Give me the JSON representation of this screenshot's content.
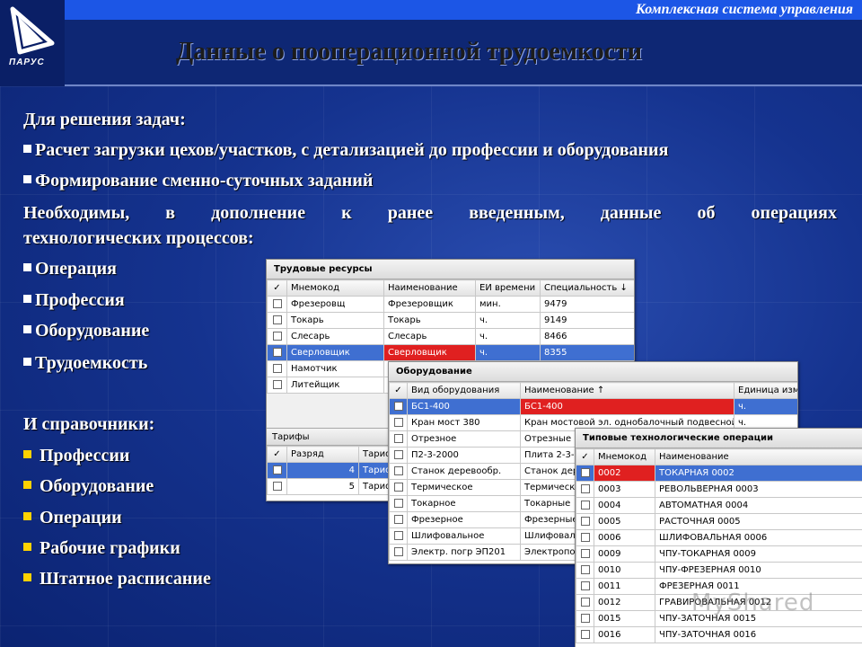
{
  "header": {
    "subtitle": "Комплексная система управления",
    "title": "Данные о пооперационной трудоемкости",
    "logo_text": "ПАРУС"
  },
  "left": {
    "heading1": "Для решения задач:",
    "tasks": [
      "Расчет загрузки цехов/участков, с детализацией до профессии и оборудования",
      "Формирование сменно-суточных заданий"
    ],
    "para_line1_words": [
      "Необходимы,",
      "в",
      "дополнение",
      "к",
      "ранее",
      "введенным,",
      "данные",
      "об",
      "операциях"
    ],
    "para_line2": "технологических процессов:",
    "data_items": [
      "Операция",
      "Профессия",
      "Оборудование",
      "Трудоемкость"
    ],
    "heading2": "И справочники:",
    "refs": [
      "Профессии",
      "Оборудование",
      "Операции",
      "Рабочие графики",
      "Штатное расписание"
    ]
  },
  "win1": {
    "title": "Трудовые ресурсы",
    "columns": [
      "✓",
      "Мнемокод",
      "Наименование",
      "ЕИ времени",
      "Специальность ↓"
    ],
    "rows": [
      {
        "code": "Фрезеровщ",
        "name": "Фрезеровщик",
        "unit": "мин.",
        "spec": "9479"
      },
      {
        "code": "Токарь",
        "name": "Токарь",
        "unit": "ч.",
        "spec": "9149"
      },
      {
        "code": "Слесарь",
        "name": "Слесарь",
        "unit": "ч.",
        "spec": "8466"
      },
      {
        "code": "Сверловщик",
        "name": "Сверловщик",
        "unit": "ч.",
        "spec": "8355"
      },
      {
        "code": "Намотчик",
        "name": "",
        "unit": "",
        "spec": ""
      },
      {
        "code": "Литейщик",
        "name": "",
        "unit": "",
        "spec": ""
      }
    ],
    "tariffs_title": "Тарифы",
    "tariff_columns": [
      "✓",
      "Разряд",
      "Тариф"
    ],
    "tariff_rows": [
      {
        "grade": "4",
        "tariff": "Тариф"
      },
      {
        "grade": "5",
        "tariff": "Тариф"
      }
    ]
  },
  "win2": {
    "title": "Оборудование",
    "columns": [
      "✓",
      "Вид оборудования",
      "Наименование ↑",
      "Единица изм"
    ],
    "rows": [
      {
        "type": "БС1-400",
        "name": "БС1-400",
        "unit": "ч."
      },
      {
        "type": "Кран мост 380",
        "name": "Кран мостовой эл. однобалочный подвесной",
        "unit": "ч."
      },
      {
        "type": "Отрезное",
        "name": "Отрезные",
        "unit": ""
      },
      {
        "type": "П2-3-2000",
        "name": "Плита 2-3-2",
        "unit": ""
      },
      {
        "type": "Станок деревообр.",
        "name": "Станок дере",
        "unit": ""
      },
      {
        "type": "Термическое",
        "name": "Термическое",
        "unit": ""
      },
      {
        "type": "Токарное",
        "name": "Токарные",
        "unit": ""
      },
      {
        "type": "Фрезерное",
        "name": "Фрезерные",
        "unit": ""
      },
      {
        "type": "Шлифовальное",
        "name": "Шлифовальн",
        "unit": ""
      },
      {
        "type": "Электр. погр ЭП201",
        "name": "Электропогр",
        "unit": ""
      }
    ]
  },
  "win3": {
    "title": "Типовые технологические операции",
    "columns": [
      "✓",
      "Мнемокод",
      "Наименование"
    ],
    "rows": [
      {
        "code": "0002",
        "name": "ТОКАРНАЯ 0002"
      },
      {
        "code": "0003",
        "name": "РЕВОЛЬВЕРНАЯ 0003"
      },
      {
        "code": "0004",
        "name": "АВТОМАТНАЯ 0004"
      },
      {
        "code": "0005",
        "name": "РАСТОЧНАЯ 0005"
      },
      {
        "code": "0006",
        "name": "ШЛИФОВАЛЬНАЯ 0006"
      },
      {
        "code": "0009",
        "name": "ЧПУ-ТОКАРНАЯ 0009"
      },
      {
        "code": "0010",
        "name": "ЧПУ-ФРЕЗЕРНАЯ 0010"
      },
      {
        "code": "0011",
        "name": "ФРЕЗЕРНАЯ 0011"
      },
      {
        "code": "0012",
        "name": "ГРАВИРОВАЛЬНАЯ 0012"
      },
      {
        "code": "0015",
        "name": "ЧПУ-ЗАТОЧНАЯ 0015"
      },
      {
        "code": "0016",
        "name": "ЧПУ-ЗАТОЧНАЯ 0016"
      }
    ]
  },
  "watermark": "MyShared",
  "colors": {
    "background": "#15338f",
    "header_strip": "#1c56e6",
    "selection": "#3f6fd1",
    "highlight_red": "#e02020",
    "bullet_yellow": "#ffd200"
  }
}
